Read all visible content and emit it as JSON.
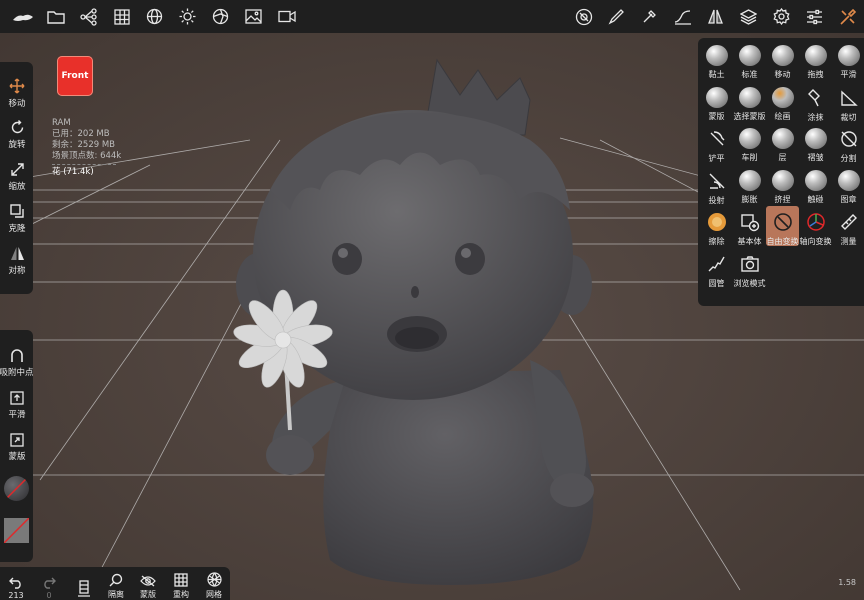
{
  "front_cube": {
    "label": "Front"
  },
  "ram": {
    "title": "RAM",
    "used": "已用：202 MB",
    "free": "剩余：2529 MB",
    "scene_vertices": "场景顶点数: 644k",
    "object": "花 (71.4k)"
  },
  "left_tools": [
    {
      "label": "移动",
      "icon": "move-icon"
    },
    {
      "label": "旋转",
      "icon": "rotate-icon"
    },
    {
      "label": "缩放",
      "icon": "scale-icon"
    },
    {
      "label": "克隆",
      "icon": "clone-icon"
    },
    {
      "label": "对称",
      "icon": "symmetry-icon"
    }
  ],
  "left_lower_tools": [
    {
      "label": "吸附中点",
      "icon": "snap-icon"
    },
    {
      "label": "平滑",
      "icon": "smooth-icon"
    },
    {
      "label": "蒙版",
      "icon": "mask-icon"
    }
  ],
  "sculpt_tools": [
    {
      "label": "黏土",
      "icon": "clay-brush-icon"
    },
    {
      "label": "标准",
      "icon": "standard-brush-icon"
    },
    {
      "label": "移动",
      "icon": "move-brush-icon"
    },
    {
      "label": "拖拽",
      "icon": "drag-brush-icon"
    },
    {
      "label": "平滑",
      "icon": "smooth-brush-icon"
    },
    {
      "label": "蒙版",
      "icon": "mask-brush-icon"
    },
    {
      "label": "选择蒙版",
      "icon": "select-mask-icon"
    },
    {
      "label": "绘画",
      "icon": "paint-brush-icon"
    },
    {
      "label": "涂抹",
      "icon": "smudge-icon"
    },
    {
      "label": "裁切",
      "icon": "trim-icon"
    },
    {
      "label": "铲平",
      "icon": "flatten-icon"
    },
    {
      "label": "车削",
      "icon": "lathe-icon"
    },
    {
      "label": "层",
      "icon": "layer-brush-icon"
    },
    {
      "label": "褶皱",
      "icon": "crease-icon"
    },
    {
      "label": "分割",
      "icon": "split-icon"
    },
    {
      "label": "投射",
      "icon": "project-icon"
    },
    {
      "label": "膨胀",
      "icon": "inflate-icon"
    },
    {
      "label": "挤捏",
      "icon": "pinch-icon"
    },
    {
      "label": "触碰",
      "icon": "tube-icon"
    },
    {
      "label": "图章",
      "icon": "stamp-icon"
    },
    {
      "label": "擦除",
      "icon": "erase-icon"
    },
    {
      "label": "基本体",
      "icon": "primitive-icon"
    },
    {
      "label": "自由变换",
      "icon": "free-transform-icon",
      "active": true
    },
    {
      "label": "轴向变换",
      "icon": "axis-transform-icon"
    },
    {
      "label": "测量",
      "icon": "measure-icon"
    },
    {
      "label": "圆管",
      "icon": "curve-tube-icon"
    },
    {
      "label": "浏览模式",
      "icon": "camera-icon"
    }
  ],
  "bottom": {
    "undo_count": "213",
    "redo_count": "0",
    "isolate": "隔离",
    "mask": "蒙版",
    "remesh": "重构",
    "mesh": "网格"
  },
  "fps": "1.58",
  "colors": {
    "bar": "#1f1f1f",
    "accent": "#b8765a",
    "scene_bg": "#4a3f3a"
  }
}
